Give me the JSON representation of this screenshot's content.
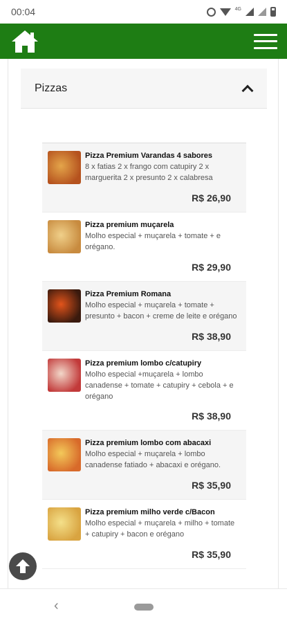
{
  "status_bar": {
    "time": "00:04",
    "network": "4G"
  },
  "app_bar": {
    "color": "#1e7d14",
    "home_icon": "home-icon",
    "menu_icon": "menu-icon"
  },
  "section": {
    "title": "Pizzas",
    "expanded": true
  },
  "products": [
    {
      "name": "Pizza Premium Varandas 4 sabores",
      "description": "8 x fatias 2 x frango com catupiry 2 x marguerita 2 x presunto 2 x calabresa",
      "price": "R$ 26,90",
      "thumb_colors": [
        "#b5521e",
        "#e4a54a"
      ]
    },
    {
      "name": "Pizza premium muçarela",
      "description": "Molho especial + muçarela + tomate + e orégano.",
      "price": "R$ 29,90",
      "thumb_colors": [
        "#c88b3f",
        "#f0d08a"
      ]
    },
    {
      "name": "Pizza Premium Romana",
      "description": "Molho especial + muçarela + tomate + presunto + bacon + creme de leite e orégano",
      "price": "R$ 38,90",
      "thumb_colors": [
        "#3a1a0e",
        "#e2541b"
      ]
    },
    {
      "name": "Pizza premium lombo c/catupiry",
      "description": "Molho especial +muçarela + lombo canadense + tomate + catupiry + cebola + e orégano",
      "price": "R$ 38,90",
      "thumb_colors": [
        "#c23a3a",
        "#f2d7c9"
      ]
    },
    {
      "name": "Pizza premium lombo com abacaxi",
      "description": "Molho especial + muçarela + lombo canadense fatiado + abacaxi e orégano.",
      "price": "R$ 35,90",
      "thumb_colors": [
        "#d86a2a",
        "#f3c95a"
      ]
    },
    {
      "name": "Pizza premium milho verde c/Bacon",
      "description": "Molho especial + muçarela + milho + tomate + catupiry + bacon e orégano",
      "price": "R$ 35,90",
      "thumb_colors": [
        "#d9a441",
        "#f4e08a"
      ]
    }
  ]
}
